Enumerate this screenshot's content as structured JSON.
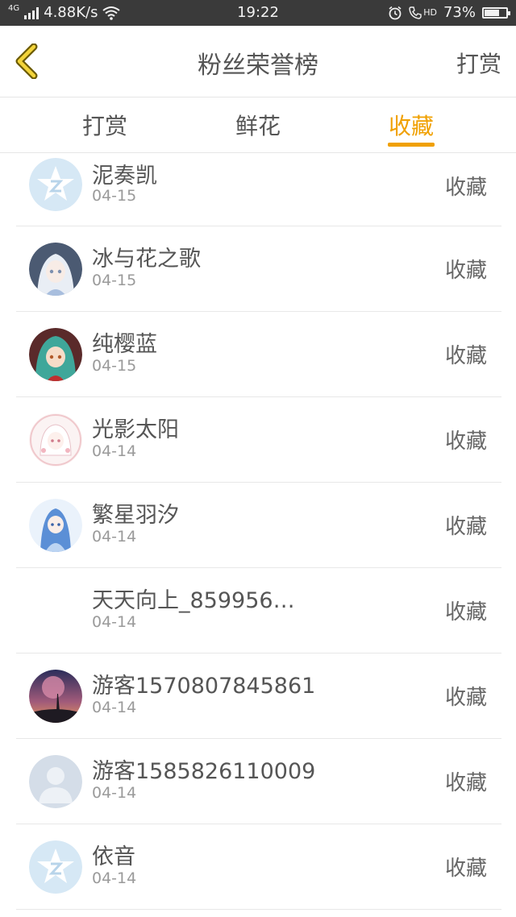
{
  "status_bar": {
    "network": "4G",
    "speed": "4.88K/s",
    "time": "19:22",
    "hd": "HD",
    "battery": "73%",
    "battery_level": 0.73
  },
  "header": {
    "title": "粉丝荣誉榜",
    "right_label": "打赏"
  },
  "tabs": [
    {
      "label": "打赏",
      "active": false
    },
    {
      "label": "鲜花",
      "active": false
    },
    {
      "label": "收藏",
      "active": true
    }
  ],
  "colors": {
    "accent": "#f0a000",
    "status_bar": "#3a3a3a"
  },
  "rows": [
    {
      "name": "泥奏凯",
      "date": "04-15",
      "action": "收藏",
      "avatar": "qq-default-icon"
    },
    {
      "name": "冰与花之歌",
      "date": "04-15",
      "action": "收藏",
      "avatar": "anime-girl-white-hair"
    },
    {
      "name": "纯樱蓝",
      "date": "04-15",
      "action": "收藏",
      "avatar": "anime-girl-green-hair"
    },
    {
      "name": "光影太阳",
      "date": "04-14",
      "action": "收藏",
      "avatar": "anime-girl-pink"
    },
    {
      "name": "繁星羽汐",
      "date": "04-14",
      "action": "收藏",
      "avatar": "anime-girl-blue"
    },
    {
      "name": "天天向上_859956…",
      "date": "04-14",
      "action": "收藏",
      "avatar": "none"
    },
    {
      "name": "游客1570807845861",
      "date": "04-14",
      "action": "收藏",
      "avatar": "night-tree"
    },
    {
      "name": "游客1585826110009",
      "date": "04-14",
      "action": "收藏",
      "avatar": "default-person-icon"
    },
    {
      "name": "依音",
      "date": "04-14",
      "action": "收藏",
      "avatar": "qq-default-icon"
    }
  ]
}
